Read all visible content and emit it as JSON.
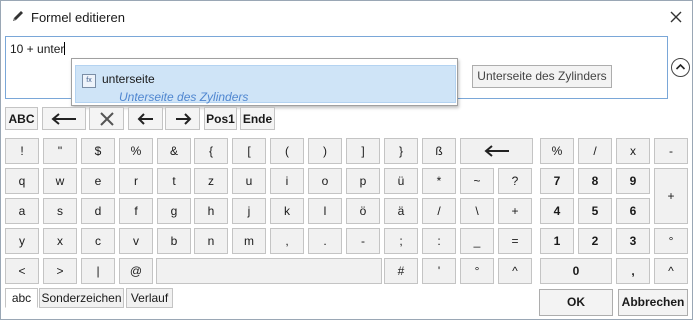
{
  "window": {
    "title": "Formel editieren",
    "edit_icon": "pencil-icon",
    "close_icon": "close-icon"
  },
  "editor": {
    "formula": "10 + unter"
  },
  "autocomplete": {
    "item_icon": "function-icon",
    "item_icon_text": "fx",
    "item_name": "unterseite",
    "item_description": "Unterseite des Zylinders"
  },
  "hint_button": "Unterseite des Zylinders",
  "expand_icon": "chevron-up-circle-icon",
  "nav": {
    "abc": "ABC",
    "backspace_icon": "backspace-arrow-icon",
    "clear_icon": "clear-x-icon",
    "left_icon": "left-arrow-icon",
    "right_icon": "right-arrow-icon",
    "pos1": "Pos1",
    "end": "Ende"
  },
  "keyboard": {
    "row1": [
      "!",
      "\"",
      "$",
      "%",
      "&",
      "{",
      "[",
      "(",
      ")",
      "]",
      "}",
      "ß"
    ],
    "row2": [
      "q",
      "w",
      "e",
      "r",
      "t",
      "z",
      "u",
      "i",
      "o",
      "p",
      "ü",
      "*",
      "~",
      "?"
    ],
    "row3": [
      "a",
      "s",
      "d",
      "f",
      "g",
      "h",
      "j",
      "k",
      "l",
      "ö",
      "ä",
      "/",
      "\\",
      "+"
    ],
    "row4": [
      "y",
      "x",
      "c",
      "v",
      "b",
      "n",
      "m",
      ",",
      ".",
      "-",
      ";",
      ":",
      "_",
      "="
    ],
    "row5": [
      "<",
      ">",
      "|",
      "@"
    ],
    "row5_right": [
      "#",
      "'",
      "°",
      "^"
    ],
    "backspace_icon": "backspace-arrow-icon"
  },
  "numpad": {
    "row1": [
      "%",
      "/",
      "x",
      "-"
    ],
    "row2": [
      "7",
      "8",
      "9"
    ],
    "row3": [
      "4",
      "5",
      "6"
    ],
    "row4": [
      "1",
      "2",
      "3"
    ],
    "plus": "+",
    "degree": "°",
    "zero": "0",
    "comma": ",",
    "caret": "^"
  },
  "tabs": [
    "abc",
    "Sonderzeichen",
    "Verlauf"
  ],
  "buttons": {
    "ok": "OK",
    "cancel": "Abbrechen"
  }
}
